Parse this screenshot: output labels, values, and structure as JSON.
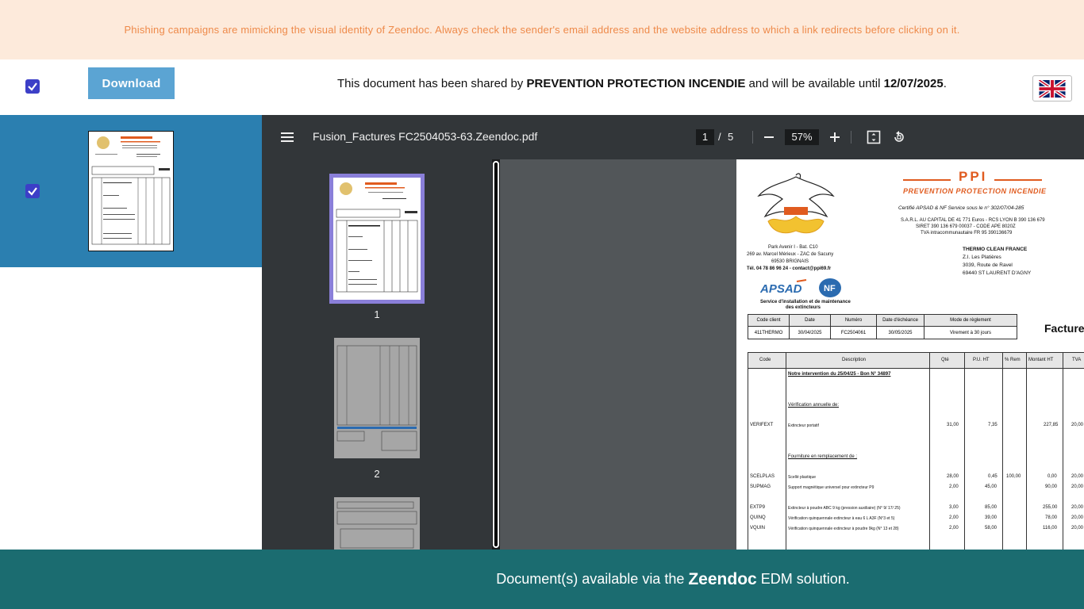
{
  "banner": {
    "text": "Phishing campaigns are mimicking the visual identity of Zeendoc. Always check the sender's email address and the website address to which a link redirects before clicking on it."
  },
  "topbar": {
    "download_label": "Download",
    "share_prefix": "This document has been shared by ",
    "company": "PREVENTION PROTECTION INCENDIE",
    "share_middle": " and will be available until ",
    "expiry_date": "12/07/2025",
    "share_suffix": ".",
    "language_flag": "uk-flag-icon"
  },
  "viewer": {
    "file_name": "Fusion_Factures FC2504053-63.Zeendoc.pdf",
    "current_page": "1",
    "page_separator": "/",
    "total_pages": "5",
    "zoom": "57%",
    "thumbnails": [
      {
        "label": "1"
      },
      {
        "label": "2"
      }
    ]
  },
  "invoice": {
    "brand": "PPI",
    "brand_sub": "PREVENTION  PROTECTION  INCENDIE",
    "cert": "Certifié APSAD & NF Service sous le n° 302/07/04-285",
    "legal1": "S.A.R.L. AU CAPITAL DE 41 771 Euros - RCS LYON B 390 136 679",
    "legal2": "SIRET 390 136 679 00037 - CODE APE 8020Z",
    "legal3": "TVA intracommunautaire FR 95 390136679",
    "addr1": "Park Avenir I - Bat. C10",
    "addr2": "269 av. Marcel Mérieux - ZAC de Sacuny",
    "addr3": "69530 BRIGNAIS",
    "addr4": "Tél. 04 78 86 96 24 - contact@ppi69.fr",
    "apsad_caption1": "Service d'installation et de maintenance",
    "apsad_caption2": "des extincteurs",
    "client_name": "THERMO CLEAN FRANCE",
    "client_addr1": "Z.I. Les Platières",
    "client_addr2": "3039, Route de Ravel",
    "client_addr3": "69440 ST LAURENT D'AGNY",
    "facture_label": "Facture",
    "header_cols": [
      "Code client",
      "Date",
      "Numéro",
      "Date d'échéance",
      "Mode de règlement"
    ],
    "header_vals": [
      "411THERMO",
      "30/04/2025",
      "FC2504061",
      "30/05/2025",
      "Virement à 30 jours"
    ],
    "line_cols": [
      "Code",
      "Description",
      "Qté",
      "P.U. HT",
      "% Rem",
      "Montant HT",
      "TVA"
    ],
    "intervention": "Notre intervention du 25/04/25 - Bon N° 34897",
    "section1": "Vérification annuelle de:",
    "section2": "Fourniture en remplacement de :",
    "lines": [
      {
        "code": "VERIFEXT",
        "desc": "Extincteur portatif",
        "qty": "31,00",
        "pu": "7,35",
        "rem": "",
        "montant": "227,85",
        "tva": "20,00"
      },
      {
        "code": "SCELPLAS",
        "desc": "Scellé plastique",
        "qty": "28,00",
        "pu": "0,45",
        "rem": "100,00",
        "montant": "0,00",
        "tva": "20,00"
      },
      {
        "code": "SUPMAG",
        "desc": "Support magnétique universel pour extincteur P9",
        "qty": "2,00",
        "pu": "45,00",
        "rem": "",
        "montant": "90,00",
        "tva": "20,00"
      },
      {
        "code": "EXTP9",
        "desc": "Extincteur à poudre ABC 9 kg (pression auxiliaire) (N° 9/ 17/ 25)",
        "qty": "3,00",
        "pu": "85,00",
        "rem": "",
        "montant": "255,00",
        "tva": "20,00"
      },
      {
        "code": "QUINQ",
        "desc": "Vérification quinquennale extincteur à eau 6 L A3F (N°3 et 5)",
        "qty": "2,00",
        "pu": "39,00",
        "rem": "",
        "montant": "78,00",
        "tva": "20,00"
      },
      {
        "code": "VQUIN",
        "desc": "Vérification quinquennale extincteur à poudre 9kg (N° 13 et 28)",
        "qty": "2,00",
        "pu": "58,00",
        "rem": "",
        "montant": "116,00",
        "tva": "20,00"
      }
    ]
  },
  "footer": {
    "prefix": "Document(s) available via the",
    "brand": "Zeendoc",
    "suffix": "EDM solution."
  },
  "colors": {
    "banner_bg": "#fdeadb",
    "banner_text": "#ee8a4a",
    "download_bg": "#5ba4d3",
    "selected_file_bg": "#2b7fb0",
    "footer_bg": "#1b6c70",
    "brand_orange": "#e05b1f"
  }
}
